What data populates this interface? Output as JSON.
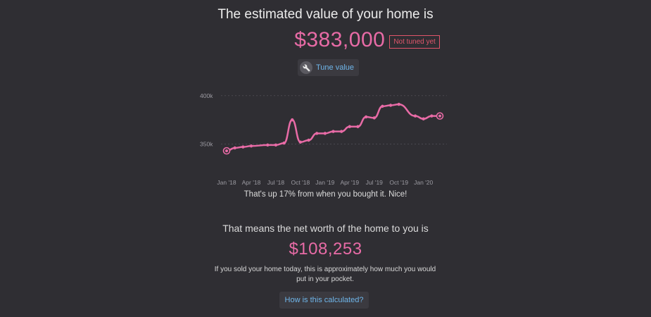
{
  "headline": "The estimated value of your home is",
  "home_value": "$383,000",
  "badge": "Not tuned yet",
  "tune_button": {
    "label": "Tune value",
    "icon": "wrench-icon"
  },
  "change_text": "That's up 17% from when you bought it. Nice!",
  "net_worth": {
    "heading": "That means the net worth of the home to you is",
    "value": "$108,253",
    "explanation": "If you sold your home today, this is approximately how much you would put in your pocket."
  },
  "how_button": {
    "label": "How is this calculated?"
  },
  "colors": {
    "background": "#2f2e33",
    "accent_pink": "#e86ba6",
    "link_blue": "#6fb6ea",
    "badge_red": "#e0556a"
  },
  "chart_data": {
    "type": "line",
    "x": [
      "2018-01",
      "2018-02",
      "2018-03",
      "2018-04",
      "2018-06",
      "2018-07",
      "2018-08",
      "2018-09",
      "2018-10",
      "2018-11",
      "2018-12",
      "2019-01",
      "2019-02",
      "2019-03",
      "2019-04",
      "2019-05",
      "2019-06",
      "2019-07",
      "2019-08",
      "2019-09",
      "2019-10",
      "2019-12",
      "2020-01",
      "2020-02",
      "2020-03"
    ],
    "series": [
      {
        "values": [
          343000,
          346000,
          347000,
          348000,
          349000,
          349000,
          351000,
          375000,
          352000,
          354000,
          361000,
          361000,
          363000,
          363000,
          368000,
          368000,
          378000,
          377000,
          389000,
          390000,
          391000,
          379000,
          376000,
          379000,
          379000
        ]
      }
    ],
    "xticks": [
      "Jan '18",
      "Apr '18",
      "Jul '18",
      "Oct '18",
      "Jan '19",
      "Apr '19",
      "Jul '19",
      "Oct '19",
      "Jan '20"
    ],
    "yticks": [
      "350k",
      "400k"
    ],
    "ylim": [
      330000,
      410000
    ],
    "xlim": [
      "2018-01",
      "2020-03"
    ],
    "grid": true,
    "color": "#e86ba6",
    "endpoint_markers": true
  }
}
